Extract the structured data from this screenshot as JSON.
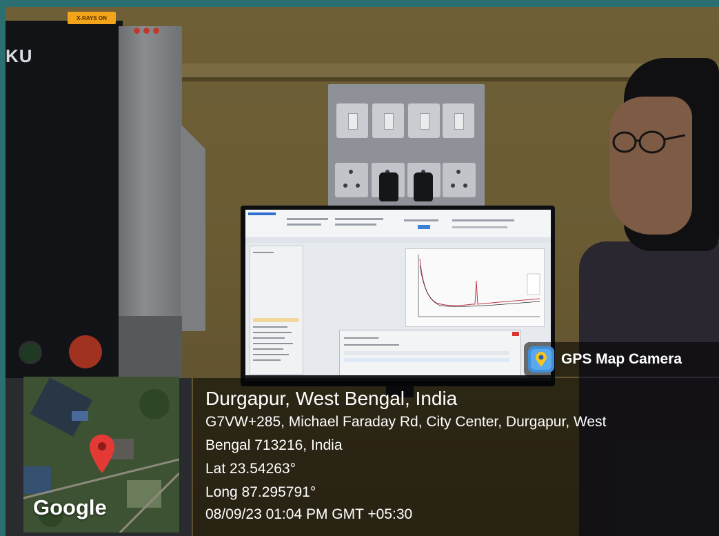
{
  "machine": {
    "warning_light_text": "X-RAYS ON",
    "brand_text": "KU"
  },
  "gps_overlay": {
    "app_name": "GPS Map Camera",
    "place_title": "Durgapur, West Bengal, India",
    "address_line_1": "G7VW+285, Michael Faraday Rd, City Center, Durgapur, West",
    "address_line_2": "Bengal 713216, India",
    "latitude": "Lat 23.54263°",
    "longitude": "Long 87.295791°",
    "datetime": "08/09/23 01:04 PM GMT +05:30",
    "map_logo": "Google"
  },
  "colors": {
    "wall": "#6e5f37",
    "overlay_bg": "#000000",
    "overlay_text": "#ffffff",
    "warning_light": "#f2a41a",
    "map_pin": "#e53935",
    "plot_trace": "#c0394b"
  },
  "icons": [
    "gps-map-camera-icon",
    "map-pin-icon"
  ]
}
